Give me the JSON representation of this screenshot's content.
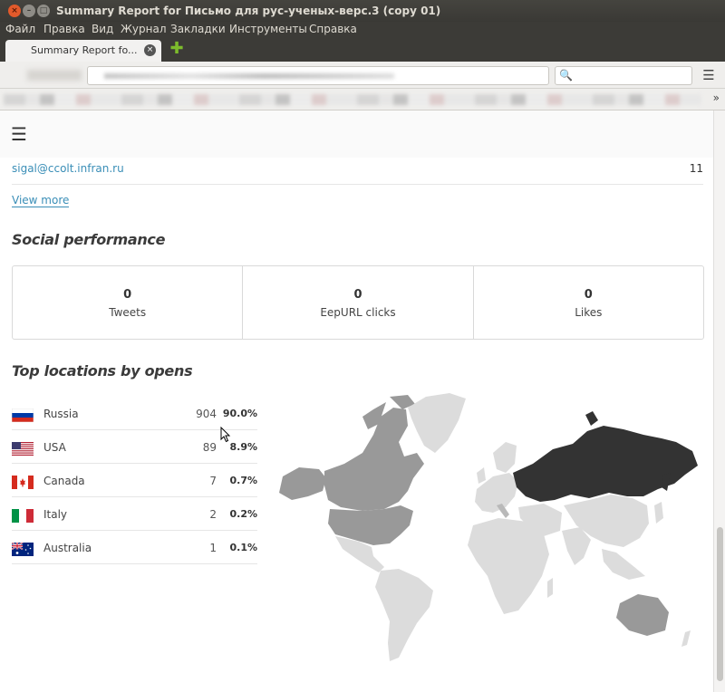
{
  "window": {
    "title": "Summary Report for Письмо для рус-ученых-верс.3 (copy 01)",
    "close_glyph": "×",
    "min_glyph": "–",
    "max_glyph": "□"
  },
  "menu": [
    "Файл",
    "Правка",
    "Вид",
    "Журнал",
    "Закладки",
    "Инструменты",
    "Справка"
  ],
  "tab": {
    "label": "Summary Report fo...",
    "close_glyph": "×"
  },
  "newtab_glyph": "✚",
  "toolbar": {
    "menu_glyph": "☰",
    "search_glyph": "🔍",
    "bookmarks_more": "»"
  },
  "page": {
    "menu_glyph": "☰",
    "email_row": {
      "email": "sigal@ccolt.infran.ru",
      "count": "11"
    },
    "view_more": "View more",
    "social_heading": "Social performance",
    "social": [
      {
        "value": "0",
        "label": "Tweets"
      },
      {
        "value": "0",
        "label": "EepURL clicks"
      },
      {
        "value": "0",
        "label": "Likes"
      }
    ],
    "locations_heading": "Top locations by opens",
    "locations": [
      {
        "country": "Russia",
        "opens": "904",
        "percent": "90.0%",
        "flag": "russia-flag"
      },
      {
        "country": "USA",
        "opens": "89",
        "percent": "8.9%",
        "flag": "usa-flag"
      },
      {
        "country": "Canada",
        "opens": "7",
        "percent": "0.7%",
        "flag": "canada-flag"
      },
      {
        "country": "Italy",
        "opens": "2",
        "percent": "0.2%",
        "flag": "italy-flag"
      },
      {
        "country": "Australia",
        "opens": "1",
        "percent": "0.1%",
        "flag": "australia-flag"
      }
    ]
  },
  "colors": {
    "link": "#3a8eb7",
    "map_highest": "#333333",
    "map_high": "#999999",
    "map_low": "#b9b9b9",
    "map_none": "#dcdcdc"
  }
}
